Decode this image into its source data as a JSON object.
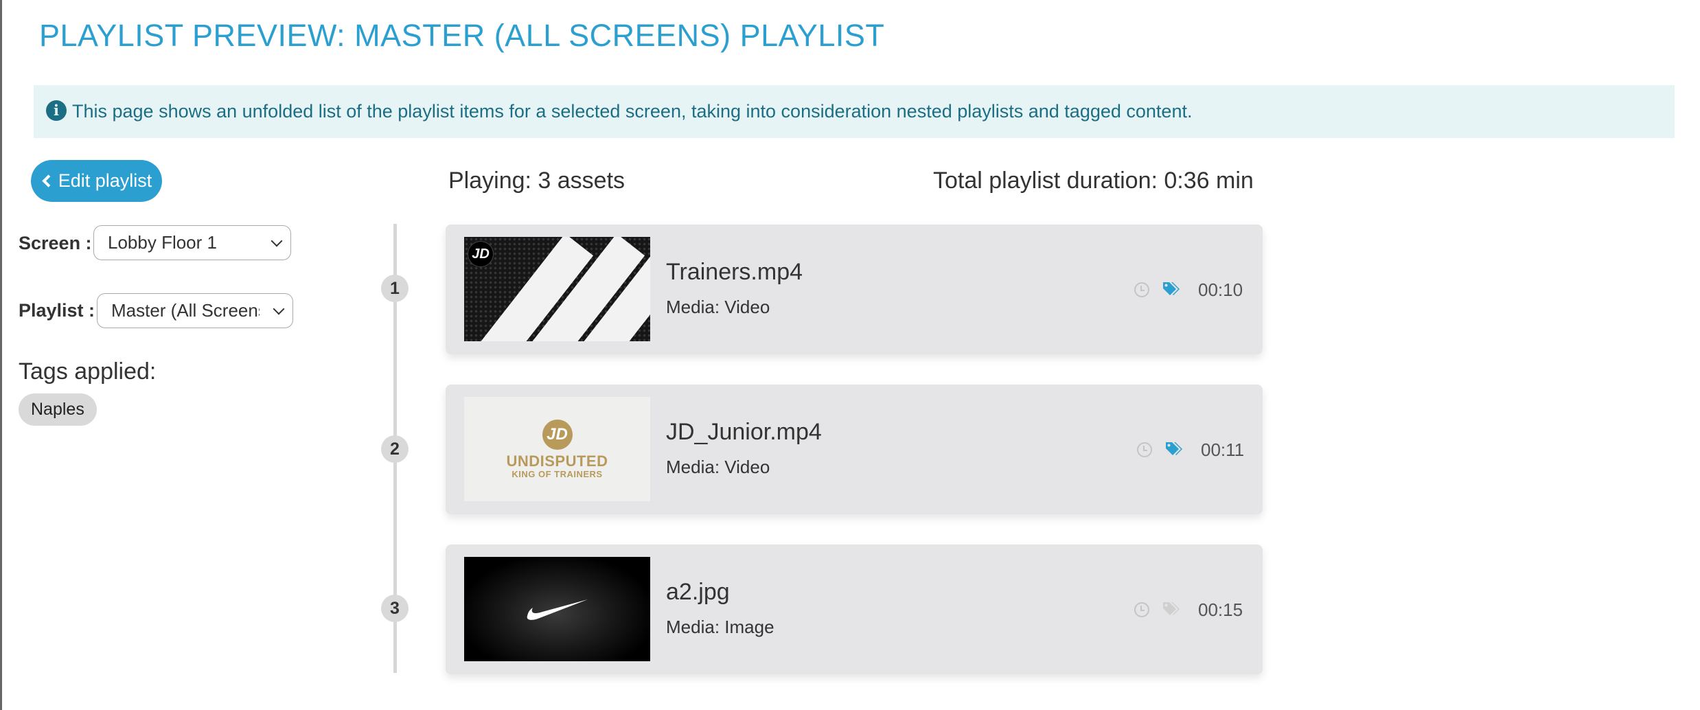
{
  "page": {
    "title": "PLAYLIST PREVIEW: MASTER (ALL SCREENS) PLAYLIST",
    "info_text": "This page shows an unfolded list of the playlist items for a selected screen, taking into consideration nested playlists and tagged content."
  },
  "sidebar": {
    "edit_button_label": "Edit playlist",
    "screen_label": "Screen :",
    "screen_value": "Lobby Floor 1",
    "playlist_label": "Playlist :",
    "playlist_value": "Master (All Screens)",
    "tags_title": "Tags applied:",
    "tags": [
      "Naples"
    ]
  },
  "summary": {
    "playing": "Playing: 3 assets",
    "total": "Total playlist duration: 0:36 min"
  },
  "items": [
    {
      "index": "1",
      "name": "Trainers.mp4",
      "media": "Media: Video",
      "duration": "00:10",
      "tagged": true,
      "thumb": "trainers-thumbnail"
    },
    {
      "index": "2",
      "name": "JD_Junior.mp4",
      "media": "Media: Video",
      "duration": "00:11",
      "tagged": true,
      "thumb": "jd-junior-thumbnail",
      "thumb_text": {
        "l1": "UNDISPUTED",
        "l2": "KING OF TRAINERS",
        "badge": "JD"
      }
    },
    {
      "index": "3",
      "name": "a2.jpg",
      "media": "Media: Image",
      "duration": "00:15",
      "tagged": false,
      "thumb": "nike-thumbnail"
    }
  ],
  "colors": {
    "accent": "#2a9fd0",
    "info_bg": "#e6f4f6",
    "info_text": "#1b6e84",
    "card_bg": "#e5e5e7",
    "tag_active": "#2a9fd0",
    "tag_inactive": "#c9c9c9"
  },
  "icons": {
    "info": "info-circle-icon",
    "edit": "chevron-left-icon",
    "clock": "clock-icon",
    "tag": "tags-icon"
  },
  "thumb_badge": "JD"
}
